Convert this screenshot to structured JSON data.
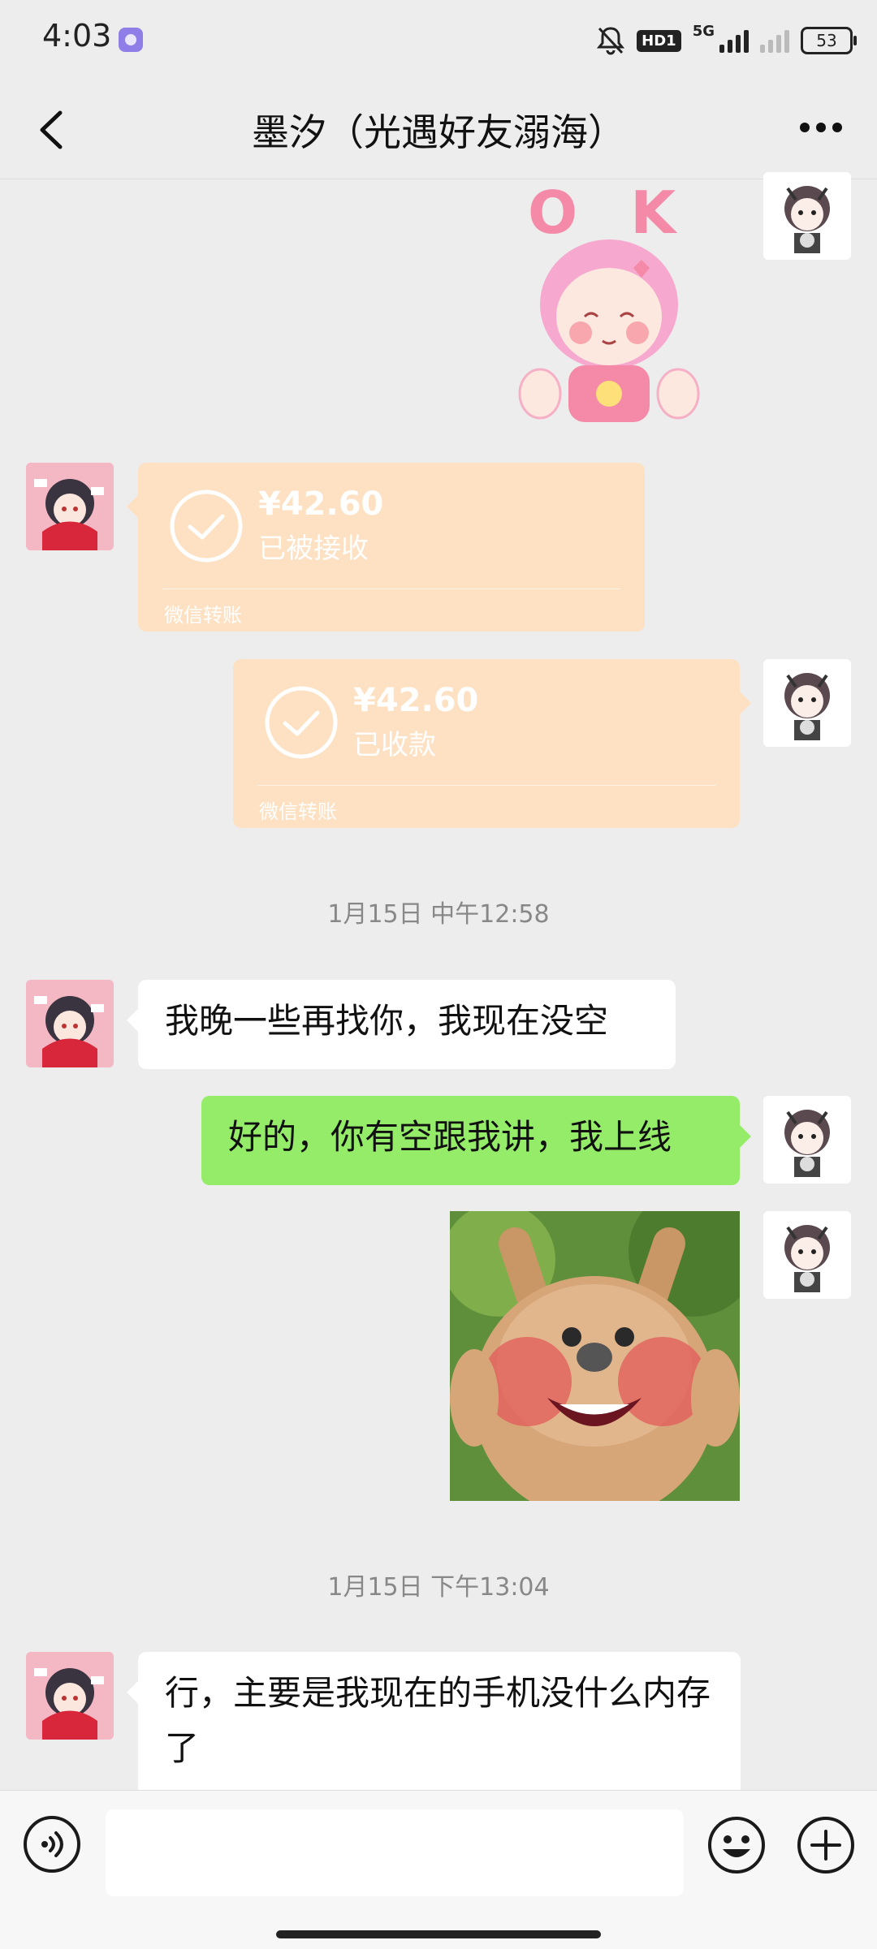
{
  "status_bar": {
    "time": "4:03",
    "network": "5G",
    "hd": "HD1",
    "battery": "53"
  },
  "header": {
    "title": "墨汐（光遇好友溺海）"
  },
  "messages": {
    "sticker_ok": {
      "text": "O K"
    },
    "transfer_received": {
      "amount": "¥42.60",
      "status": "已被接收",
      "source": "微信转账"
    },
    "transfer_collected": {
      "amount": "¥42.60",
      "status": "已收款",
      "source": "微信转账"
    },
    "timestamp1": "1月15日 中午12:58",
    "msg1": "我晚一些再找你，我现在没空",
    "msg2": "好的，你有空跟我讲，我上线",
    "timestamp2": "1月15日 下午13:04",
    "msg3": "行，主要是我现在的手机没什么内存了"
  },
  "colors": {
    "green_bubble": "#95ec69",
    "transfer_bg": "#fde1c2",
    "background": "#ededed"
  }
}
